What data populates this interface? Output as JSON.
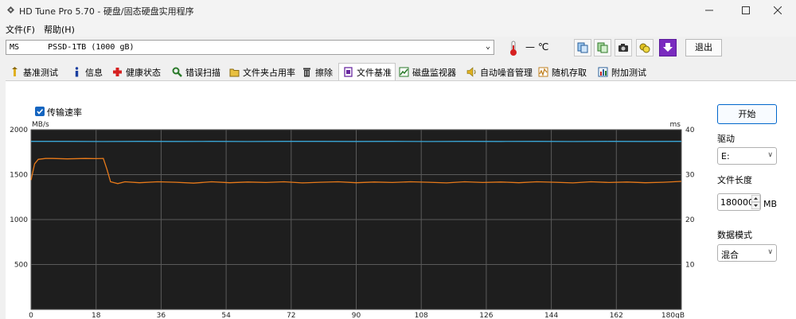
{
  "window": {
    "title": "HD Tune Pro 5.70 - 硬盘/固态硬盘实用程序"
  },
  "menu": [
    {
      "label": "文件(F)"
    },
    {
      "label": "帮助(H)"
    }
  ],
  "toolbar": {
    "drive_value": "MS      PSSD-1TB (1000 gB)",
    "temperature": "— ℃",
    "exit_label": "退出"
  },
  "tabs": [
    {
      "label": "基准测试",
      "icon": "benchmark-icon"
    },
    {
      "label": "信息",
      "icon": "info-icon"
    },
    {
      "label": "健康状态",
      "icon": "health-icon"
    },
    {
      "label": "错误扫描",
      "icon": "error-scan-icon"
    },
    {
      "label": "文件夹占用率",
      "icon": "folder-icon"
    },
    {
      "label": "擦除",
      "icon": "erase-icon"
    },
    {
      "label": "文件基准",
      "icon": "file-benchmark-icon",
      "active": true
    },
    {
      "label": "磁盘监视器",
      "icon": "disk-monitor-icon"
    },
    {
      "label": "自动噪音管理",
      "icon": "speaker-icon"
    },
    {
      "label": "随机存取",
      "icon": "random-access-icon"
    },
    {
      "label": "附加测试",
      "icon": "extra-tests-icon"
    }
  ],
  "panel": {
    "transfer_rate_label": "传输速率",
    "transfer_rate_checked": true
  },
  "side": {
    "start_label": "开始",
    "drive_label": "驱动",
    "drive_value": "E:",
    "file_length_label": "文件长度",
    "file_length_value": "180000",
    "file_length_unit": "MB",
    "data_mode_label": "数据模式",
    "data_mode_value": "混合"
  },
  "colors": {
    "write_line": "#e87a1a",
    "read_line": "#3aa6d6",
    "chart_bg": "#1e1e1e",
    "grid": "#5a5a5a",
    "accent": "#0066cc"
  },
  "chart_data": {
    "type": "line",
    "y_left_unit": "MB/s",
    "y_right_unit": "ms",
    "y_left_ticks": [
      "2000",
      "1500",
      "1000",
      "500"
    ],
    "y_right_ticks": [
      "40",
      "30",
      "20",
      "10"
    ],
    "x_ticks": [
      "0",
      "18",
      "36",
      "54",
      "72",
      "90",
      "108",
      "126",
      "144",
      "162",
      "180gB"
    ],
    "ylim_left": [
      0,
      2000
    ],
    "ylim_right": [
      0,
      40
    ],
    "xlim": [
      0,
      180
    ],
    "grid": true,
    "series": [
      {
        "axis": "left",
        "color": "#e87a1a",
        "x": [
          0,
          1,
          2,
          4,
          6,
          10,
          15,
          18,
          20,
          21,
          22,
          24,
          26,
          30,
          35,
          40,
          45,
          50,
          55,
          60,
          65,
          70,
          75,
          80,
          85,
          90,
          95,
          100,
          105,
          110,
          115,
          120,
          125,
          130,
          135,
          140,
          145,
          150,
          155,
          160,
          165,
          170,
          175,
          180
        ],
        "y": [
          1440,
          1620,
          1670,
          1680,
          1680,
          1675,
          1680,
          1678,
          1680,
          1560,
          1420,
          1400,
          1420,
          1410,
          1420,
          1415,
          1405,
          1420,
          1410,
          1418,
          1412,
          1420,
          1408,
          1415,
          1420,
          1410,
          1418,
          1412,
          1420,
          1415,
          1408,
          1420,
          1412,
          1418,
          1410,
          1420,
          1415,
          1408,
          1420,
          1412,
          1418,
          1410,
          1415,
          1425
        ]
      },
      {
        "axis": "left",
        "color": "#3aa6d6",
        "x": [
          0,
          10,
          20,
          30,
          40,
          50,
          60,
          70,
          80,
          90,
          100,
          110,
          120,
          130,
          140,
          150,
          160,
          170,
          180
        ],
        "y": [
          1870,
          1870,
          1868,
          1870,
          1869,
          1870,
          1868,
          1870,
          1870,
          1869,
          1870,
          1868,
          1870,
          1869,
          1870,
          1868,
          1870,
          1869,
          1870
        ]
      }
    ]
  }
}
